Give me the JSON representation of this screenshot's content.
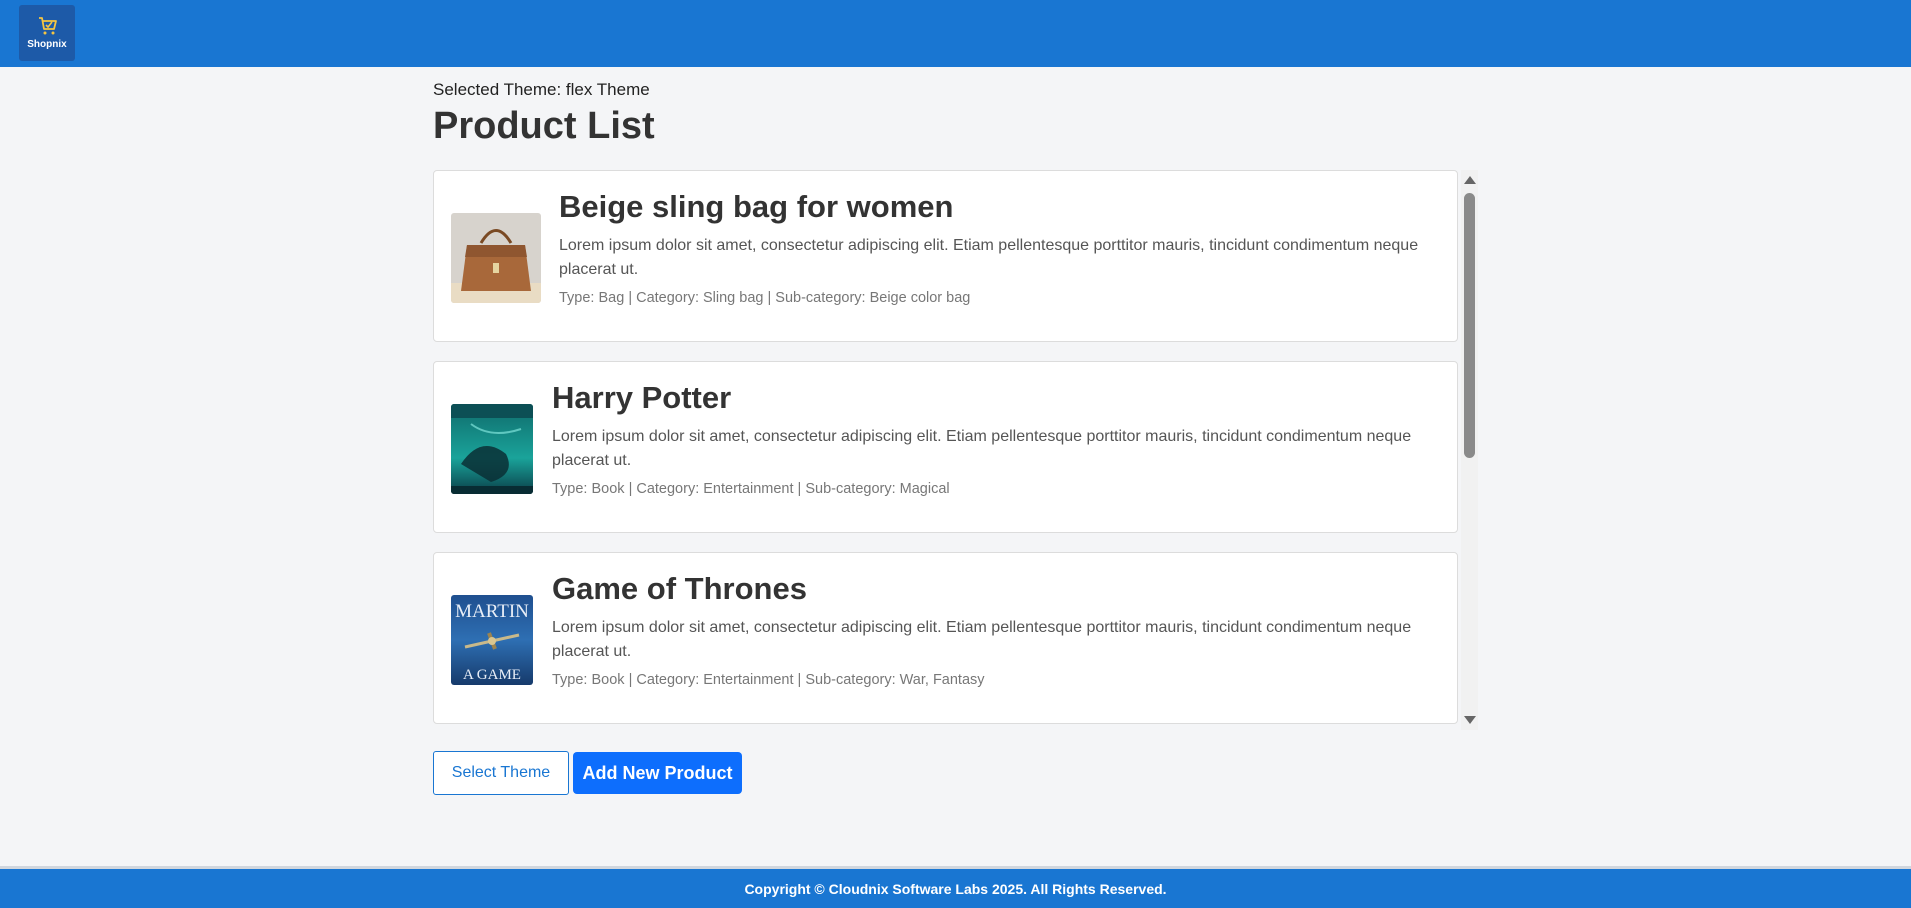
{
  "header": {
    "logo_text": "Shopnix",
    "logo_icon": "shopping-bag-icon",
    "background": "#1976d2"
  },
  "main": {
    "selected_theme": "Selected Theme: flex Theme",
    "title": "Product List"
  },
  "products": [
    {
      "title": "Beige sling bag for women",
      "description": "Lorem ipsum dolor sit amet, consectetur adipiscing elit. Etiam pellentesque porttitor mauris, tincidunt condimentum neque placerat ut.",
      "meta": "Type: Bag | Category: Sling bag | Sub-category: Beige color bag",
      "image": "brown-handbag-image"
    },
    {
      "title": "Harry Potter",
      "description": "Lorem ipsum dolor sit amet, consectetur adipiscing elit. Etiam pellentesque porttitor mauris, tincidunt condimentum neque placerat ut.",
      "meta": "Type: Book | Category: Entertainment | Sub-category: Magical",
      "image": "harry-potter-book-cover-image"
    },
    {
      "title": "Game of Thrones",
      "description": "Lorem ipsum dolor sit amet, consectetur adipiscing elit. Etiam pellentesque porttitor mauris, tincidunt condimentum neque placerat ut.",
      "meta": "Type: Book | Category: Entertainment | Sub-category: War, Fantasy",
      "image": "game-of-thrones-book-cover-image",
      "cover_text_top": "MARTIN",
      "cover_text_bottom": "A GAME"
    }
  ],
  "actions": {
    "select_theme_label": "Select Theme",
    "add_product_label": "Add New Product",
    "accent": "#0d6efd"
  },
  "footer": {
    "copyright": "Copyright © Cloudnix Software Labs 2025. All Rights Reserved."
  }
}
